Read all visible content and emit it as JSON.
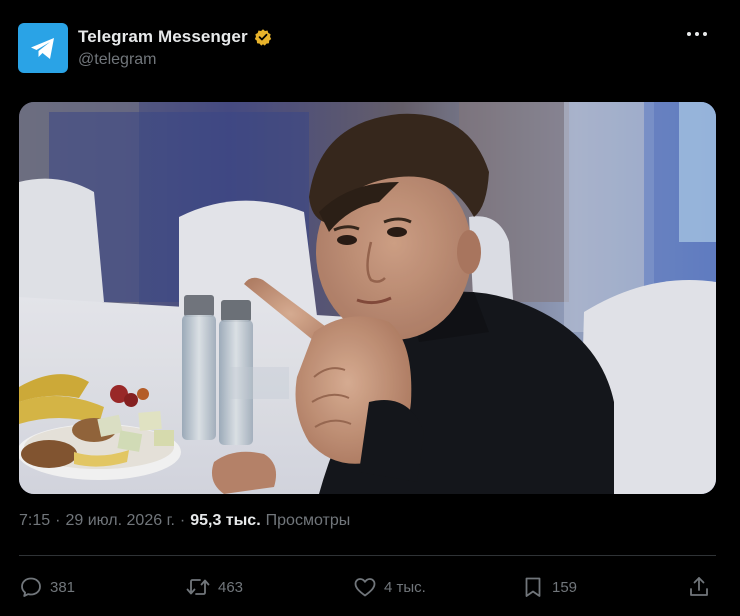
{
  "author": {
    "display_name": "Telegram Messenger",
    "handle": "@telegram",
    "avatar_icon": "telegram-paper-plane-icon",
    "verified_icon": "verified-badge-icon",
    "brand_color": "#2aa3e6",
    "verified_color": "#e8b32b"
  },
  "menu": {
    "more_icon": "more-dots-icon"
  },
  "media": {
    "type": "photo"
  },
  "meta": {
    "time": "7:15",
    "separator": "·",
    "date": "29 июл. 2026 г.",
    "views_count": "95,3 тыс.",
    "views_label": "Просмотры"
  },
  "actions": {
    "replies": {
      "icon": "reply-icon",
      "count": "381"
    },
    "reposts": {
      "icon": "repost-icon",
      "count": "463"
    },
    "likes": {
      "icon": "like-heart-icon",
      "count": "4 тыс."
    },
    "bookmarks": {
      "icon": "bookmark-icon",
      "count": "159"
    },
    "share": {
      "icon": "share-icon"
    }
  },
  "colors": {
    "background": "#000000",
    "text_primary": "#e7e9ea",
    "text_secondary": "#71767b",
    "divider": "#2f3336"
  }
}
